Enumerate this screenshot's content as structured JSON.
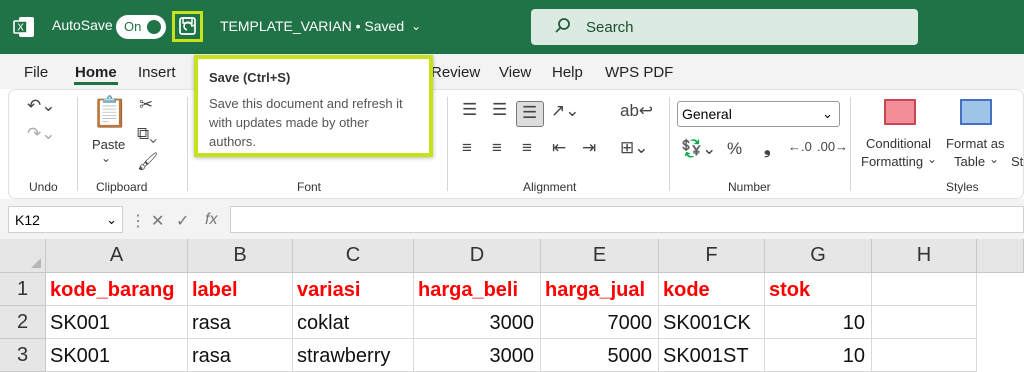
{
  "titlebar": {
    "autosave_label": "AutoSave",
    "toggle_text": "On",
    "doc_title": "TEMPLATE_VARIAN • Saved",
    "search_placeholder": "Search"
  },
  "menu": [
    "File",
    "Home",
    "Insert",
    "Review",
    "View",
    "Help",
    "WPS PDF"
  ],
  "ribbon": {
    "groups": [
      "Undo",
      "Clipboard",
      "Font",
      "Alignment",
      "Number",
      "Styles"
    ],
    "paste_label": "Paste",
    "number_format": "General",
    "conditional_formatting": "Conditional",
    "conditional_formatting_2": "Formatting",
    "format_as_table": "Format as",
    "format_as_table_2": "Table",
    "cell_styles": "St"
  },
  "tooltip": {
    "title": "Save (Ctrl+S)",
    "body": "Save this document and refresh it with updates made by other authors."
  },
  "formula": {
    "name_box": "K12",
    "fx": "fx"
  },
  "sheet": {
    "columns": [
      "A",
      "B",
      "C",
      "D",
      "E",
      "F",
      "G",
      "H"
    ],
    "rows": [
      "1",
      "2",
      "3"
    ],
    "header": [
      "kode_barang",
      "label",
      "variasi",
      "harga_beli",
      "harga_jual",
      "kode",
      "stok"
    ],
    "data": [
      [
        "SK001",
        "rasa",
        "coklat",
        "3000",
        "7000",
        "SK001CK",
        "10"
      ],
      [
        "SK001",
        "rasa",
        "strawberry",
        "3000",
        "5000",
        "SK001ST",
        "10"
      ]
    ]
  }
}
